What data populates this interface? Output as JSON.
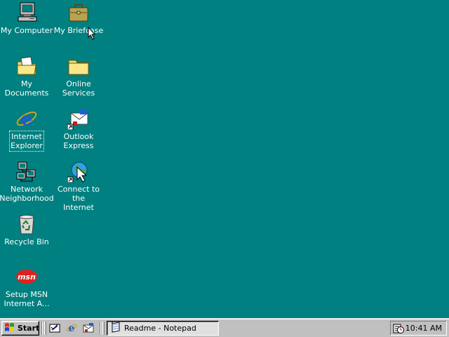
{
  "desktop": {
    "icons": [
      {
        "label": "My Computer",
        "icon": "computer-icon"
      },
      {
        "label": "My Briefcase",
        "icon": "briefcase-icon"
      },
      {
        "label": "My Documents",
        "icon": "documents-folder-icon"
      },
      {
        "label": "Online\nServices",
        "icon": "folder-icon"
      },
      {
        "label": "Internet\nExplorer",
        "icon": "internet-explorer-icon"
      },
      {
        "label": "Outlook\nExpress",
        "icon": "outlook-express-icon"
      },
      {
        "label": "Network\nNeighborhood",
        "icon": "network-icon"
      },
      {
        "label": "Connect to the\nInternet",
        "icon": "connect-wizard-icon"
      },
      {
        "label": "Recycle Bin",
        "icon": "recycle-bin-icon"
      },
      {
        "label": "Setup MSN\nInternet A...",
        "icon": "msn-icon"
      }
    ],
    "background_color": "#008080"
  },
  "taskbar": {
    "start_label": "Start",
    "quick_launch": [
      "show-desktop-icon",
      "internet-explorer-icon",
      "outlook-express-icon"
    ],
    "tasks": [
      {
        "label": "Readme - Notepad",
        "icon": "notepad-icon",
        "active": true
      }
    ],
    "tray": {
      "icons": [
        "task-scheduler-icon"
      ],
      "clock": "10:41 AM"
    }
  },
  "msn_logo_text": "msn"
}
